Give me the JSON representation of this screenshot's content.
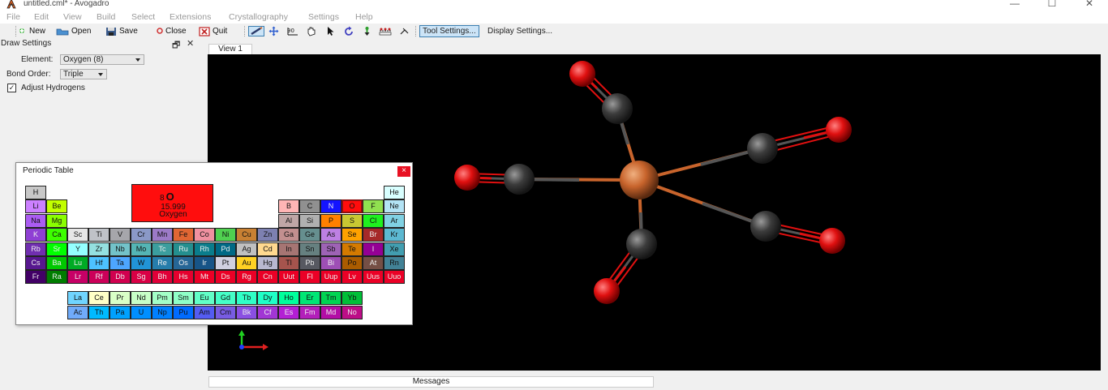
{
  "window": {
    "title": "untitled.cml* - Avogadro",
    "minimize": "—",
    "maximize": "☐",
    "close": "✕"
  },
  "menu": [
    "File",
    "Edit",
    "View",
    "Build",
    "Select",
    "Extensions",
    "Crystallography",
    "Settings",
    "Help"
  ],
  "toolbar": {
    "new_label": "New",
    "open_label": "Open",
    "save_label": "Save",
    "close_label": "Close",
    "quit_label": "Quit",
    "tool_settings": "Tool Settings...",
    "display_settings": "Display Settings..."
  },
  "draw_settings": {
    "title": "Draw Settings",
    "float": "🗗",
    "close": "✕",
    "element_label": "Element:",
    "element_value": "Oxygen (8)",
    "bond_label": "Bond Order:",
    "bond_value": "Triple",
    "adjust_h_label": "Adjust Hydrogens",
    "adjust_h_checked": "✓"
  },
  "view": {
    "tab": "View 1"
  },
  "messages": {
    "label": "Messages"
  },
  "periodic": {
    "title": "Periodic Table",
    "close": "×",
    "selected": {
      "number": "8",
      "symbol": "O",
      "mass": "15.999",
      "name": "Oxygen",
      "color": "#ff0d0d"
    },
    "main": [
      [
        "H",
        "",
        "",
        "",
        "",
        "",
        "",
        "",
        "",
        "",
        "",
        "",
        "",
        "",
        "",
        "",
        "",
        "He"
      ],
      [
        "Li",
        "Be",
        "",
        "",
        "",
        "",
        "",
        "",
        "",
        "",
        "",
        "",
        "B",
        "C",
        "N",
        "O",
        "F",
        "Ne"
      ],
      [
        "Na",
        "Mg",
        "",
        "",
        "",
        "",
        "",
        "",
        "",
        "",
        "",
        "",
        "Al",
        "Si",
        "P",
        "S",
        "Cl",
        "Ar"
      ],
      [
        "K",
        "Ca",
        "Sc",
        "Ti",
        "V",
        "Cr",
        "Mn",
        "Fe",
        "Co",
        "Ni",
        "Cu",
        "Zn",
        "Ga",
        "Ge",
        "As",
        "Se",
        "Br",
        "Kr"
      ],
      [
        "Rb",
        "Sr",
        "Y",
        "Zr",
        "Nb",
        "Mo",
        "Tc",
        "Ru",
        "Rh",
        "Pd",
        "Ag",
        "Cd",
        "In",
        "Sn",
        "Sb",
        "Te",
        "I",
        "Xe"
      ],
      [
        "Cs",
        "Ba",
        "Lu",
        "Hf",
        "Ta",
        "W",
        "Re",
        "Os",
        "Ir",
        "Pt",
        "Au",
        "Hg",
        "Tl",
        "Pb",
        "Bi",
        "Po",
        "At",
        "Rn"
      ],
      [
        "Fr",
        "Ra",
        "Lr",
        "Rf",
        "Db",
        "Sg",
        "Bh",
        "Hs",
        "Mt",
        "Ds",
        "Rg",
        "Cn",
        "Uut",
        "Fl",
        "Uup",
        "Lv",
        "Uus",
        "Uuo"
      ]
    ],
    "f_block": [
      [
        "La",
        "Ce",
        "Pr",
        "Nd",
        "Pm",
        "Sm",
        "Eu",
        "Gd",
        "Tb",
        "Dy",
        "Ho",
        "Er",
        "Tm",
        "Yb"
      ],
      [
        "Ac",
        "Th",
        "Pa",
        "U",
        "Np",
        "Pu",
        "Am",
        "Cm",
        "Bk",
        "Cf",
        "Es",
        "Fm",
        "Md",
        "No"
      ]
    ],
    "colors": {
      "H": "#c8c8c8",
      "He": "#d9ffff",
      "Li": "#cc80ff",
      "Be": "#c2ff00",
      "B": "#ffb5b5",
      "C": "#909090",
      "N": "#1414ff",
      "O": "#ff0d0d",
      "F": "#90e050",
      "Ne": "#b3e3f5",
      "Na": "#ab5cf2",
      "Mg": "#8aff00",
      "Al": "#bfa6a6",
      "Si": "#b0b0b0",
      "P": "#ff8000",
      "S": "#c8c832",
      "Cl": "#1ff01f",
      "Ar": "#80d1e3",
      "K": "#8f40d4",
      "Ca": "#3dff00",
      "Sc": "#e6e6e6",
      "Ti": "#bfc2c7",
      "V": "#a6a6ab",
      "Cr": "#8a99c7",
      "Mn": "#9c7ac7",
      "Fe": "#e06633",
      "Co": "#f090a0",
      "Ni": "#50d050",
      "Cu": "#c88033",
      "Zn": "#7d80b0",
      "Ga": "#c28f8f",
      "Ge": "#668f8f",
      "As": "#bd80e3",
      "Se": "#ffa100",
      "Br": "#a62929",
      "Kr": "#5cb8d1",
      "Rb": "#702eb0",
      "Sr": "#00ff00",
      "Y": "#94ffff",
      "Zr": "#94e0e0",
      "Nb": "#73c2c9",
      "Mo": "#54b5b5",
      "Tc": "#3b9e9e",
      "Ru": "#248f8f",
      "Rh": "#0a7d8c",
      "Pd": "#006985",
      "Ag": "#c0c0c0",
      "Cd": "#ffd98f",
      "In": "#a67573",
      "Sn": "#668080",
      "Sb": "#9e63b5",
      "Te": "#d47a00",
      "I": "#940094",
      "Xe": "#429eb0",
      "Cs": "#57178f",
      "Ba": "#00c900",
      "Lu": "#00ab24",
      "Hf": "#4dc2ff",
      "Ta": "#4da6ff",
      "W": "#2194d6",
      "Re": "#267dab",
      "Os": "#266696",
      "Ir": "#175487",
      "Pt": "#d0d0e0",
      "Au": "#ffd123",
      "Hg": "#b8b8d0",
      "Tl": "#a6544d",
      "Pb": "#575961",
      "Bi": "#9e4fb5",
      "Po": "#ab5c00",
      "At": "#754f45",
      "Rn": "#428296",
      "Fr": "#420066",
      "Ra": "#007d00",
      "Lr": "#c70066",
      "Rf": "#cc0059",
      "Db": "#d1004f",
      "Sg": "#d90045",
      "Bh": "#e00038",
      "Hs": "#e6002e",
      "Mt": "#eb0026",
      "Ds": "#eb0026",
      "Rg": "#eb0026",
      "Cn": "#eb0026",
      "Uut": "#eb0026",
      "Fl": "#eb0026",
      "Uup": "#eb0026",
      "Lv": "#eb0026",
      "Uus": "#eb0026",
      "Uuo": "#eb0026",
      "La": "#70d4ff",
      "Ce": "#ffffc7",
      "Pr": "#d9ffc7",
      "Nd": "#c7ffc7",
      "Pm": "#a3ffc7",
      "Sm": "#8fffc7",
      "Eu": "#61ffc7",
      "Gd": "#45ffc7",
      "Tb": "#30ffc7",
      "Dy": "#1fffc7",
      "Ho": "#00ff9c",
      "Er": "#00e675",
      "Tm": "#00d452",
      "Yb": "#00bf38",
      "Ac": "#70abfa",
      "Th": "#00baff",
      "Pa": "#00a1ff",
      "U": "#008fff",
      "Np": "#0080ff",
      "Pu": "#006bff",
      "Am": "#545cf2",
      "Cm": "#785ce3",
      "Bk": "#8a4fe3",
      "Cf": "#a136d4",
      "Es": "#b31fd4",
      "Fm": "#b31fba",
      "Md": "#b30da6",
      "No": "#bd0d87"
    },
    "light_text": [
      "N",
      "K",
      "Rb",
      "Cs",
      "Fr",
      "Ra",
      "I",
      "Br",
      "Ir",
      "Os",
      "Re",
      "Rh",
      "Ru",
      "Tc",
      "Pd",
      "At",
      "Pb",
      "Bi",
      "Lr",
      "Rf",
      "Db",
      "Sg",
      "Bh",
      "Hs",
      "Mt",
      "Ds",
      "Rg",
      "Cn",
      "Uut",
      "Fl",
      "Uup",
      "Lv",
      "Uus",
      "Uuo",
      "Bk",
      "Cf",
      "Es",
      "Fm",
      "Md",
      "No",
      "Ba",
      "Lu",
      "Sr"
    ]
  },
  "colors": {
    "viewport_bg": "#000000",
    "oxygen": "#e01010",
    "carbon": "#3c3c3c",
    "iron": "#c8642c",
    "axis_x": "#e02020",
    "axis_y": "#20d020",
    "axis_z": "#2040ff"
  }
}
